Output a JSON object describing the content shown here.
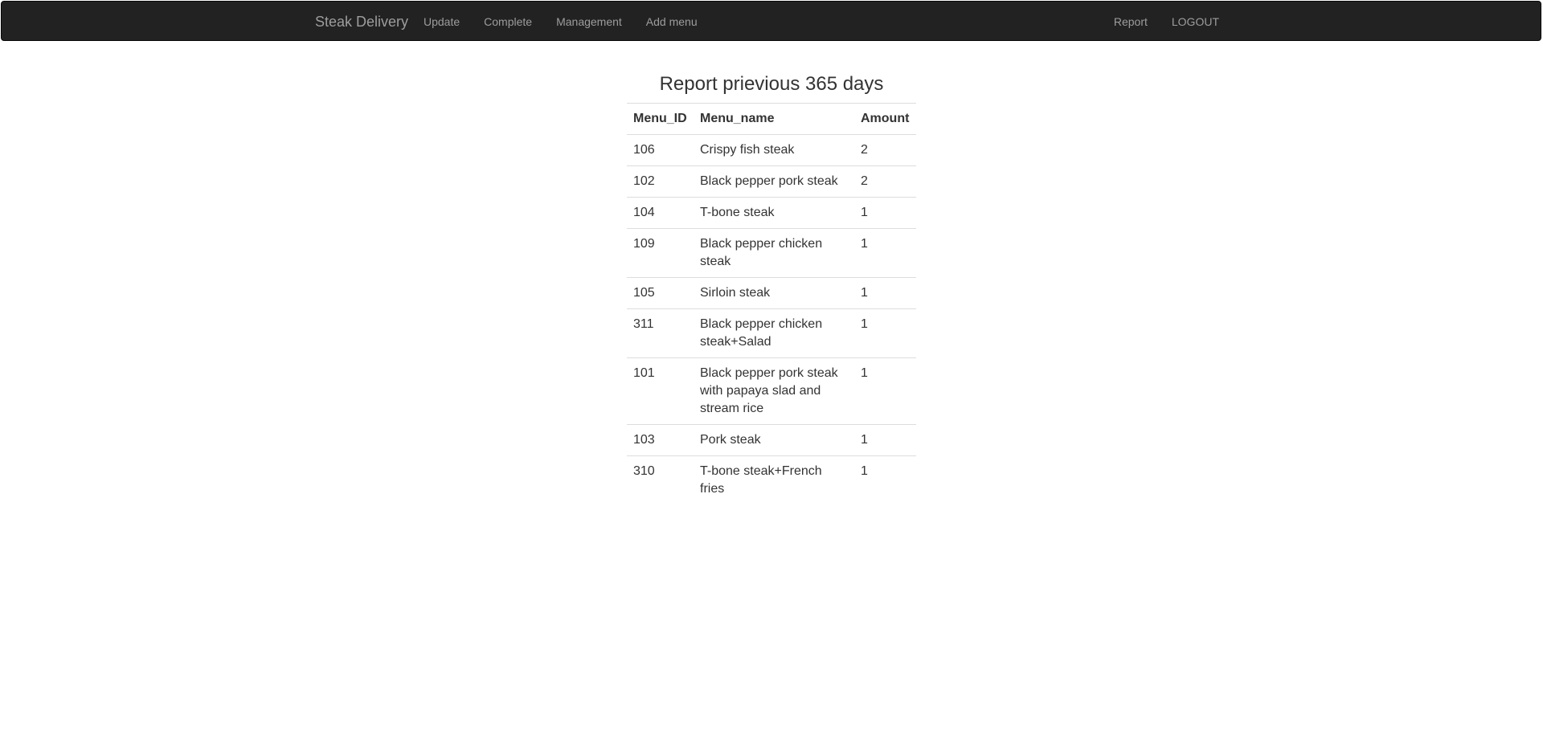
{
  "navbar": {
    "brand": "Steak Delivery",
    "left_links": [
      "Update",
      "Complete",
      "Management",
      "Add menu"
    ],
    "right_links": [
      "Report",
      "LOGOUT"
    ]
  },
  "report": {
    "title": "Report prievious 365 days",
    "columns": [
      "Menu_ID",
      "Menu_name",
      "Amount"
    ],
    "rows": [
      {
        "id": "106",
        "name": "Crispy fish steak",
        "amount": "2"
      },
      {
        "id": "102",
        "name": "Black pepper pork steak",
        "amount": "2"
      },
      {
        "id": "104",
        "name": "T-bone steak",
        "amount": "1"
      },
      {
        "id": "109",
        "name": "Black pepper chicken steak",
        "amount": "1"
      },
      {
        "id": "105",
        "name": "Sirloin steak",
        "amount": "1"
      },
      {
        "id": "311",
        "name": "Black pepper chicken steak+Salad",
        "amount": "1"
      },
      {
        "id": "101",
        "name": "Black pepper pork steak with papaya slad and stream rice",
        "amount": "1"
      },
      {
        "id": "103",
        "name": "Pork steak",
        "amount": "1"
      },
      {
        "id": "310",
        "name": "T-bone steak+French fries",
        "amount": "1"
      }
    ]
  }
}
